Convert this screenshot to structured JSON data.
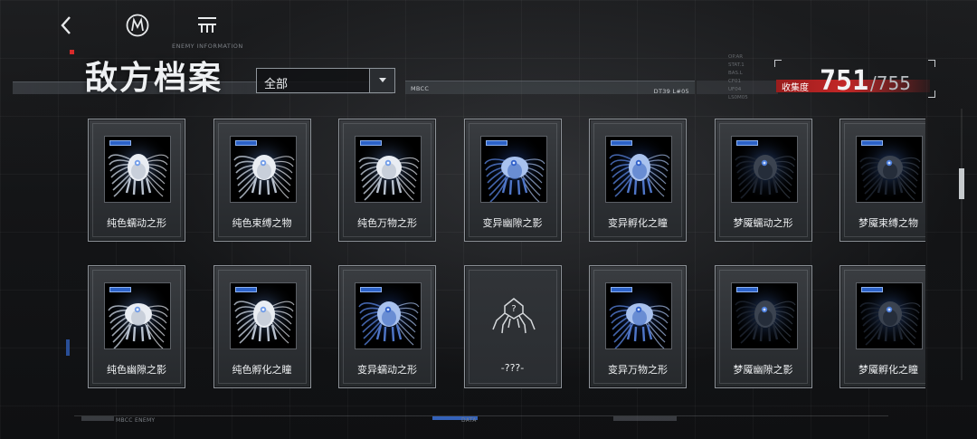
{
  "header": {
    "title_cn": "敌方档案",
    "title_en": "ENEMY INFORMATION",
    "filter_value": "全部",
    "line_label_left": "MBCC",
    "line_label_right": "DT39 L#05"
  },
  "collection": {
    "label": "收集度",
    "current": "751",
    "total": "/755"
  },
  "side_list": [
    "OP.AR",
    "STAT.1",
    "BAS.L",
    "CF01",
    "UF04",
    "LS0M05"
  ],
  "cards": [
    {
      "name": "纯色蠕动之形",
      "tone": "white"
    },
    {
      "name": "纯色束缚之物",
      "tone": "white"
    },
    {
      "name": "纯色万物之形",
      "tone": "white"
    },
    {
      "name": "变异幽隙之影",
      "tone": "blue"
    },
    {
      "name": "变异孵化之瞳",
      "tone": "blue"
    },
    {
      "name": "梦魇蠕动之形",
      "tone": "dark"
    },
    {
      "name": "梦魇束缚之物",
      "tone": "dark"
    },
    {
      "name": "纯色幽隙之影",
      "tone": "white"
    },
    {
      "name": "纯色孵化之瞳",
      "tone": "white"
    },
    {
      "name": "变异蠕动之形",
      "tone": "blue"
    },
    {
      "name": "-???-",
      "tone": "unknown"
    },
    {
      "name": "变异万物之形",
      "tone": "blue"
    },
    {
      "name": "梦魇幽隙之影",
      "tone": "dark"
    },
    {
      "name": "梦魇孵化之瞳",
      "tone": "dark"
    }
  ],
  "footer": {
    "label_1": "MBCC ENEMY",
    "label_2": "DATA"
  },
  "colors": {
    "accent_red": "#c32727",
    "accent_blue": "#2c62c8"
  }
}
